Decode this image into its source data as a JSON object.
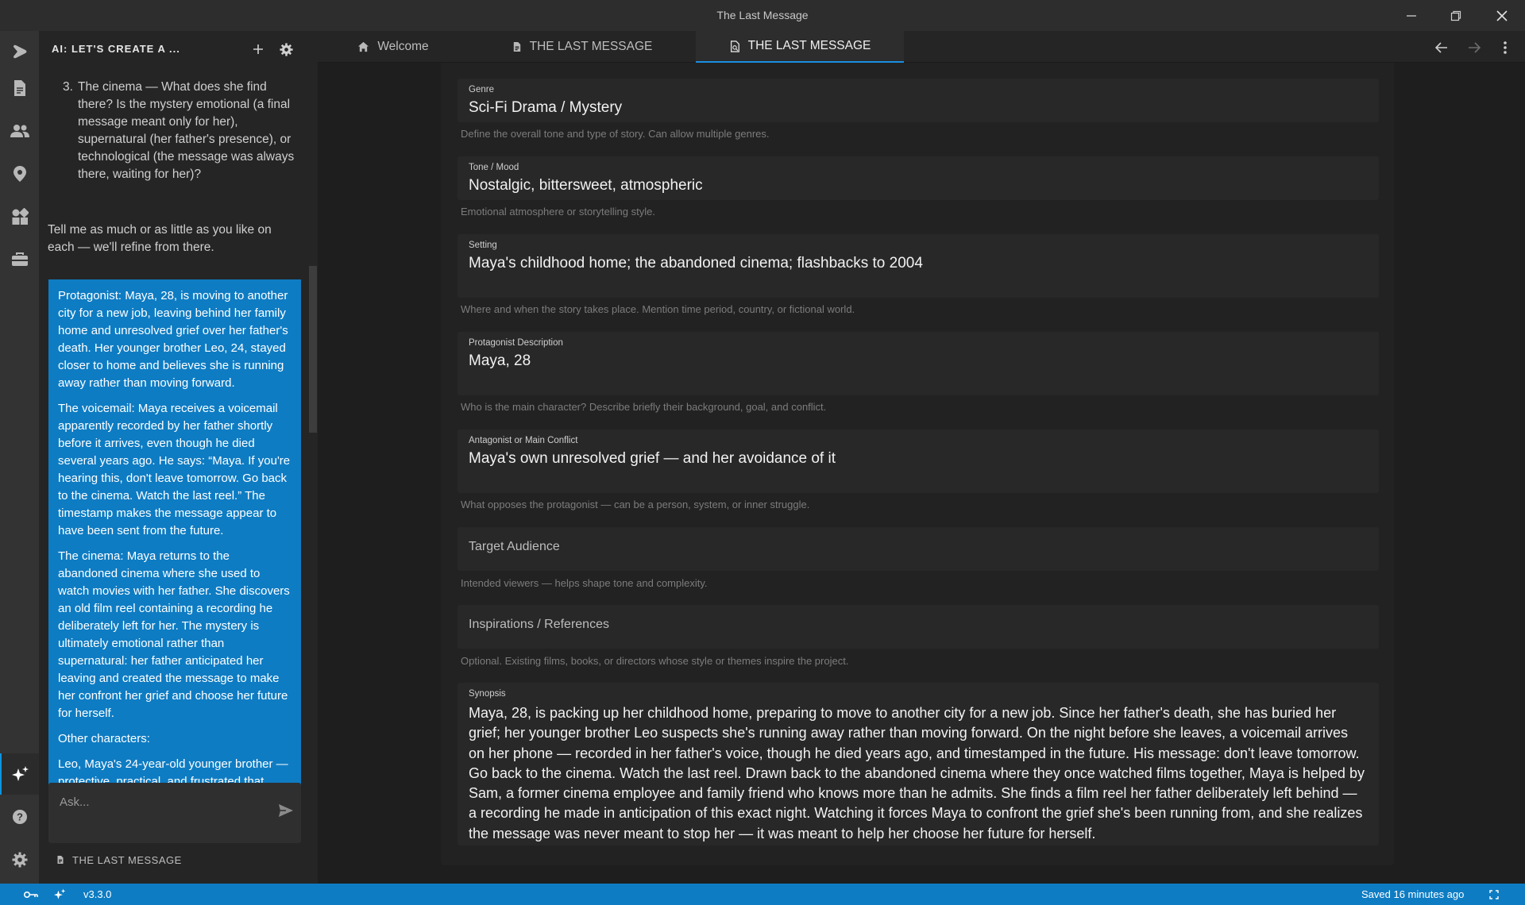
{
  "window": {
    "title": "The Last Message"
  },
  "activity_bar": {
    "items": [
      "logo",
      "documents",
      "characters",
      "locations",
      "elements",
      "toolkit"
    ],
    "bottom": [
      "ai-assistant",
      "help",
      "settings"
    ]
  },
  "chat": {
    "header_title": "AI: LET'S CREATE A ...",
    "ai_list_item": {
      "number": "3.",
      "text": "The cinema — What does she find there? Is the mystery emotional (a final message meant only for her), supernatural (her father's presence), or technological (the message was always there, waiting for her)?"
    },
    "ai_tail": "Tell me as much or as little as you like on each — we'll refine from there.",
    "user_message": [
      "Protagonist: Maya, 28, is moving to another city for a new job, leaving behind her family home and unresolved grief over her father's death. Her younger brother Leo, 24, stayed closer to home and believes she is running away rather than moving forward.",
      "The voicemail: Maya receives a voicemail apparently recorded by her father shortly before it arrives, even though he died several years ago. He says: “Maya. If you're hearing this, don't leave tomorrow. Go back to the cinema. Watch the last reel.” The timestamp makes the message appear to have been sent from the future.",
      "The cinema: Maya returns to the abandoned cinema where she used to watch movies with her father. She discovers an old film reel containing a recording he deliberately left for her. The mystery is ultimately emotional rather than supernatural: her father anticipated her leaving and created the message to make her confront her grief and choose her future for herself.",
      "Other characters:",
      "Leo, Maya's 24-year-old younger brother — protective, practical, and frustrated that"
    ],
    "input_placeholder": "Ask...",
    "footer_label": "THE LAST MESSAGE"
  },
  "tabs": [
    {
      "label": "Welcome",
      "icon": "home-icon",
      "active": false
    },
    {
      "label": "THE LAST MESSAGE",
      "icon": "document-icon",
      "active": false
    },
    {
      "label": "THE LAST MESSAGE",
      "icon": "project-doc-icon",
      "active": true
    }
  ],
  "fields": {
    "genre": {
      "label": "Genre",
      "value": "Sci-Fi Drama / Mystery",
      "help": "Define the overall tone and type of story. Can allow multiple genres."
    },
    "tone": {
      "label": "Tone / Mood",
      "value": "Nostalgic, bittersweet, atmospheric",
      "help": "Emotional atmosphere or storytelling style."
    },
    "setting": {
      "label": "Setting",
      "value": "Maya's childhood home; the abandoned cinema; flashbacks to 2004",
      "help": "Where and when the story takes place. Mention time period, country, or fictional world."
    },
    "protagonist": {
      "label": "Protagonist Description",
      "value": "Maya, 28",
      "help": "Who is the main character? Describe briefly their background, goal, and conflict."
    },
    "antagonist": {
      "label": "Antagonist or Main Conflict",
      "value": "Maya's own unresolved grief — and her avoidance of it",
      "help": "What opposes the protagonist — can be a person, system, or inner struggle."
    },
    "audience": {
      "placeholder": "Target Audience",
      "help": "Intended viewers — helps shape tone and complexity."
    },
    "inspirations": {
      "placeholder": "Inspirations / References",
      "help": "Optional. Existing films, books, or directors whose style or themes inspire the project."
    },
    "synopsis": {
      "label": "Synopsis",
      "value": "Maya, 28, is packing up her childhood home, preparing to move to another city for a new job. Since her father's death, she has buried her grief; her younger brother Leo suspects she's running away rather than moving forward. On the night before she leaves, a voicemail arrives on her phone — recorded in her father's voice, though he died years ago, and timestamped in the future. His message: don't leave tomorrow. Go back to the cinema. Watch the last reel. Drawn back to the abandoned cinema where they once watched films together, Maya is helped by Sam, a former cinema employee and family friend who knows more than he admits. She finds a film reel her father deliberately left behind — a recording he made in anticipation of this exact night. Watching it forces Maya to confront the grief she's been running from, and she realizes the message was never meant to stop her — it was meant to help her choose her future for herself."
    }
  },
  "status": {
    "version": "v3.3.0",
    "saved": "Saved 16 minutes ago"
  },
  "colors": {
    "accent": "#0e7cc3",
    "background": "#1e1e1e"
  }
}
